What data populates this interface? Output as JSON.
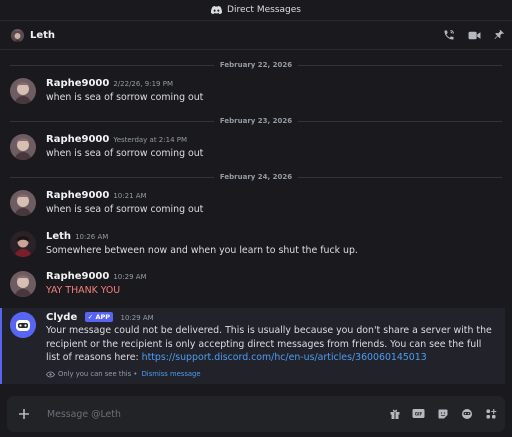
{
  "titlebar": {
    "title": "Direct Messages"
  },
  "header": {
    "name": "Leth"
  },
  "dividers": [
    "February 22, 2026",
    "February 23, 2026",
    "February 24, 2026"
  ],
  "messages": [
    {
      "author": "Raphe9000",
      "time": "2/22/26, 9:19 PM",
      "text": "when is sea of sorrow coming out"
    },
    {
      "author": "Raphe9000",
      "time": "Yesterday at 2:14 PM",
      "text": "when is sea of sorrow coming out"
    },
    {
      "author": "Raphe9000",
      "time": "10:21 AM",
      "text": "when is sea of sorrow coming out"
    },
    {
      "author": "Leth",
      "time": "10:26 AM",
      "text": "Somewhere between now and when you learn to shut the fuck up."
    },
    {
      "author": "Raphe9000",
      "time": "10:29 AM",
      "text": "YAY THANK YOU"
    }
  ],
  "clyde": {
    "author": "Clyde",
    "badge": "APP",
    "time": "10:29 AM",
    "text": "Your message could not be delivered. This is usually because you don't share a server with the recipient or the recipient is only accepting direct messages from friends. You can see the full list of reasons here: ",
    "link": "https://support.discord.com/hc/en-us/articles/360060145013",
    "only_you": "Only you can see this",
    "separator": "•",
    "dismiss": "Dismiss message"
  },
  "composer": {
    "placeholder": "Message @Leth"
  },
  "colors": {
    "accent": "#5865f2",
    "link": "#4e9bf5",
    "error_text": "#f3807f"
  }
}
